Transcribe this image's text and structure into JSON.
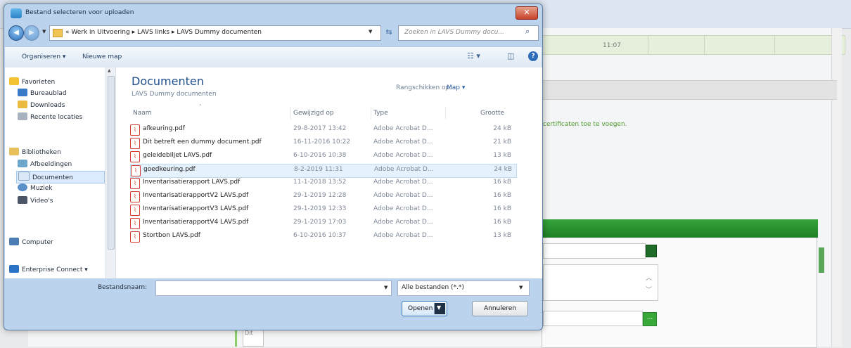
{
  "background": {
    "table_cell_text": "11:07",
    "green_message": "certificaten toe te voegen.",
    "add_button_label": "...",
    "doc_fragment": "Dit"
  },
  "dialog": {
    "title": "Bestand selecteren voor uploaden",
    "close_label": "✕",
    "address": [
      "« Werk in Uitvoering",
      "LAVS links",
      "LAVS Dummy documenten"
    ],
    "search_placeholder": "Zoeken in LAVS Dummy docu...",
    "toolbar": {
      "organize_label": "Organiseren ▾",
      "new_folder_label": "Nieuwe map"
    },
    "nav": {
      "items": [
        {
          "label": "Favorieten",
          "icon": "star-icon"
        },
        {
          "label": "Bureaublad",
          "icon": "desktop-icon"
        },
        {
          "label": "Downloads",
          "icon": "downloads-icon"
        },
        {
          "label": "Recente locaties",
          "icon": "recent-places-icon"
        },
        {
          "label": "Bibliotheken",
          "icon": "libraries-icon"
        },
        {
          "label": "Afbeeldingen",
          "icon": "pictures-icon"
        },
        {
          "label": "Documenten",
          "icon": "documents-icon"
        },
        {
          "label": "Muziek",
          "icon": "music-icon"
        },
        {
          "label": "Video's",
          "icon": "videos-icon"
        },
        {
          "label": "Computer",
          "icon": "computer-icon"
        },
        {
          "label": "Enterprise Connect ▾",
          "icon": "network-icon"
        }
      ],
      "selected": "Documenten"
    },
    "library": {
      "title": "Documenten",
      "subtitle": "LAVS Dummy documenten",
      "arrange_label": "Rangschikken op:",
      "arrange_value": "Map ▾"
    },
    "columns": [
      "Naam",
      "Gewijzigd op",
      "Type",
      "Grootte"
    ],
    "files": [
      {
        "name": "afkeuring.pdf",
        "date": "29-8-2017 13:42",
        "type": "Adobe Acrobat D...",
        "size": "24 kB"
      },
      {
        "name": "Dit betreft een dummy document.pdf",
        "date": "16-11-2016 10:22",
        "type": "Adobe Acrobat D...",
        "size": "21 kB"
      },
      {
        "name": "geleidebiljet LAVS.pdf",
        "date": "6-10-2016 10:38",
        "type": "Adobe Acrobat D...",
        "size": "13 kB"
      },
      {
        "name": "goedkeuring.pdf",
        "date": "8-2-2019 11:31",
        "type": "Adobe Acrobat D...",
        "size": "24 kB"
      },
      {
        "name": "Inventarisatierapport LAVS.pdf",
        "date": "11-1-2018 13:52",
        "type": "Adobe Acrobat D...",
        "size": "16 kB"
      },
      {
        "name": "InventarisatierapportV2 LAVS.pdf",
        "date": "29-1-2019 12:28",
        "type": "Adobe Acrobat D...",
        "size": "16 kB"
      },
      {
        "name": "InventarisatierapportV3 LAVS.pdf",
        "date": "29-1-2019 12:33",
        "type": "Adobe Acrobat D...",
        "size": "16 kB"
      },
      {
        "name": "InventarisatierapportV4 LAVS.pdf",
        "date": "29-1-2019 17:03",
        "type": "Adobe Acrobat D...",
        "size": "16 kB"
      },
      {
        "name": "Stortbon LAVS.pdf",
        "date": "6-10-2016 10:37",
        "type": "Adobe Acrobat D...",
        "size": "13 kB"
      }
    ],
    "selected_file": "goedkeuring.pdf",
    "filename_label": "Bestandsnaam:",
    "filename_value": "",
    "filter_value": "Alle bestanden (*.*)",
    "open_label": "Openen",
    "cancel_label": "Annuleren"
  },
  "colors": {
    "accent_green": "#2e9a35",
    "selection_blue": "#dbeafd",
    "pdf_red": "#d43a2f"
  }
}
